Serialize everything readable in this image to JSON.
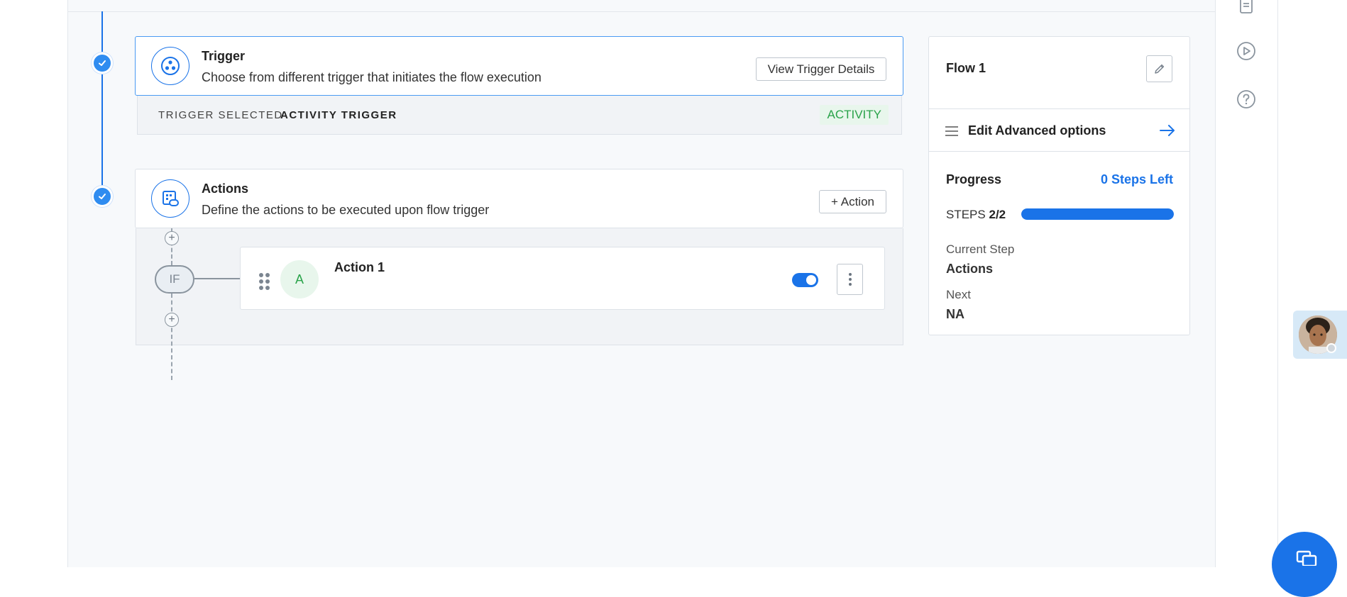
{
  "trigger": {
    "title": "Trigger",
    "description": "Choose from different trigger that initiates the flow execution",
    "details_button": "View Trigger Details",
    "selected_label": "TRIGGER SELECTED",
    "selected_value": "ACTIVITY TRIGGER",
    "badge": "ACTIVITY"
  },
  "actions": {
    "title": "Actions",
    "description": "Define the actions to be executed upon flow trigger",
    "add_button": "+ Action",
    "if_label": "IF",
    "items": [
      {
        "avatar": "A",
        "title": "Action 1",
        "enabled": true
      }
    ]
  },
  "side_panel": {
    "flow_name": "Flow 1",
    "advanced_options": "Edit Advanced options",
    "progress_title": "Progress",
    "steps_left": "0 Steps Left",
    "steps_label": "STEPS",
    "steps_value": "2/2",
    "progress_fraction": 1.0,
    "current_step_label": "Current Step",
    "current_step_value": "Actions",
    "next_label": "Next",
    "next_value": "NA"
  },
  "icons": {
    "right_rail": [
      "document-icon",
      "play-circle-icon",
      "help-circle-icon"
    ]
  },
  "colors": {
    "accent": "#1a73e8",
    "success": "#2aa34a"
  }
}
